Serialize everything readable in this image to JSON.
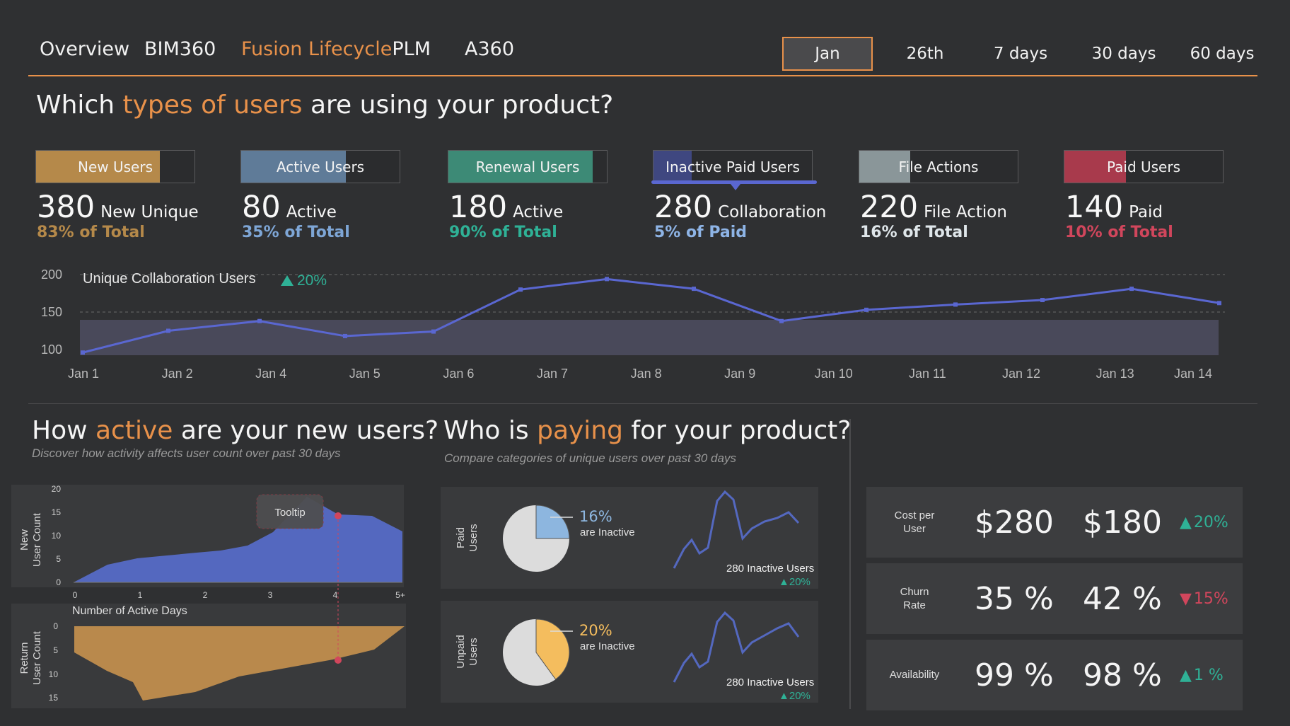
{
  "nav": {
    "tabs": [
      "Overview",
      "BIM360",
      "Fusion Lifecycle",
      "PLM",
      "A360"
    ],
    "time_filters": [
      "Jan",
      "26th",
      "7 days",
      "30 days",
      "60 days"
    ],
    "selected_time": "Jan"
  },
  "section1": {
    "title_pre": "Which ",
    "title_accent": "types of users",
    "title_post": " are using your product?"
  },
  "user_cards": [
    {
      "label": "New Users",
      "value": "380",
      "unit": "New Unique",
      "pct": "83% of Total",
      "color": "#b5894a",
      "pct_color": "#b5894a",
      "fill": 0.78
    },
    {
      "label": "Active Users",
      "value": "80",
      "unit": "Active",
      "pct": "35% of Total",
      "color": "#5f7b98",
      "pct_color": "#7ea6d6",
      "fill": 0.66
    },
    {
      "label": "Renewal Users",
      "value": "180",
      "unit": "Active",
      "pct": "90% of Total",
      "color": "#3d8a76",
      "pct_color": "#2fb196",
      "fill": 0.91
    },
    {
      "label": "Inactive Paid Users",
      "value": "280",
      "unit": "Collaboration",
      "pct": "5% of Paid",
      "color": "#3f4780",
      "pct_color": "#8eb4e6",
      "fill": 0.24
    },
    {
      "label": "File Actions",
      "value": "220",
      "unit": "File Action",
      "pct": "16% of Total",
      "color": "#8a9699",
      "pct_color": "#dfe6ea",
      "fill": 0.32
    },
    {
      "label": "Paid Users",
      "value": "140",
      "unit": "Paid",
      "pct": "10% of Total",
      "color": "#a83a4c",
      "pct_color": "#d1465c",
      "fill": 0.39
    }
  ],
  "collab_chart": {
    "title": "Unique Collaboration Users",
    "change": "20%",
    "chart_data": {
      "type": "line",
      "title": "Unique Collaboration Users",
      "categories": [
        "Jan 1",
        "Jan 2",
        "Jan 4",
        "Jan 5",
        "Jan 6",
        "Jan 7",
        "Jan 8",
        "Jan 9",
        "Jan 10",
        "Jan 11",
        "Jan 12",
        "Jan 13",
        "Jan 14"
      ],
      "x": [
        0,
        1,
        2,
        3,
        4,
        4.65,
        5.55,
        6.45,
        7.45,
        8.35,
        9.35,
        10.35,
        11.35,
        12.2,
        12.95
      ],
      "values": [
        96,
        125,
        138,
        118,
        124,
        180,
        194,
        181,
        138,
        153,
        160,
        166,
        181,
        162
      ],
      "yticks": [
        100,
        150,
        200
      ],
      "ylim": [
        90,
        205
      ]
    }
  },
  "section2": {
    "title_pre": "How ",
    "title_accent": "active",
    "title_post": " are your new users?",
    "subtitle": "Discover how activity affects user count over past 30 days",
    "tooltip": "Tooltip",
    "top_ylabel": "New\nUser Count",
    "bottom_ylabel": "Return\nUser Count",
    "xlabel": "Number of Active Days",
    "xticks": [
      "0",
      "1",
      "2",
      "3",
      "4",
      "5+"
    ],
    "top_yticks": [
      "0",
      "5",
      "10",
      "15",
      "20"
    ],
    "bottom_yticks": [
      "0",
      "5",
      "10",
      "15"
    ]
  },
  "section3": {
    "title_pre": "Who is ",
    "title_accent": "paying",
    "title_post": " for your product?",
    "subtitle": "Compare categories of unique users over past 30 days",
    "rows": [
      {
        "label": "Paid\nUsers",
        "pct": "16%",
        "text": "are Inactive",
        "color": "#8db6df",
        "share": 0.25,
        "inactive": "280 Inactive Users",
        "change": "20%"
      },
      {
        "label": "Unpaid\nUsers",
        "pct": "20%",
        "text": "are Inactive",
        "color": "#f4bd5e",
        "share": 0.4,
        "inactive": "280 Inactive Users",
        "change": "20%"
      }
    ]
  },
  "kpis": [
    {
      "name": "Cost per\nUser",
      "v1": "$280",
      "v2": "$180",
      "change": "20%",
      "dir": "up"
    },
    {
      "name": "Churn\nRate",
      "v1": "35 %",
      "v2": "42 %",
      "change": "15%",
      "dir": "down"
    },
    {
      "name": "Availability",
      "v1": "99 %",
      "v2": "98 %",
      "change": "1 %",
      "dir": "up"
    }
  ],
  "colors": {
    "accent": "#e8914a",
    "line": "#5a67d1",
    "area_blue": "#5468bf",
    "area_gold": "#b9894c",
    "positive": "#2fb196",
    "negative": "#d1465c"
  }
}
